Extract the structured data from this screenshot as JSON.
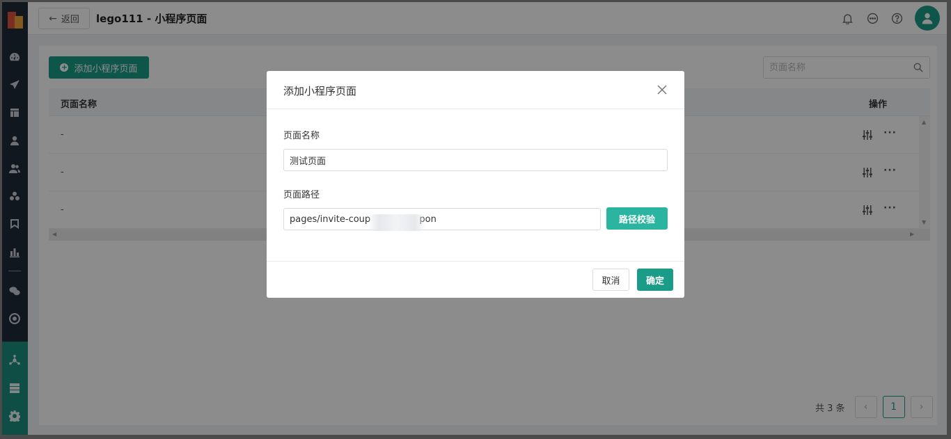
{
  "header": {
    "back_label": "返回",
    "title": "lego111 - 小程序页面"
  },
  "toolbar": {
    "add_label": "添加小程序页面",
    "search_placeholder": "页面名称"
  },
  "table": {
    "columns": [
      "页面名称",
      "操作"
    ],
    "rows": [
      {
        "name": "-"
      },
      {
        "name": "-"
      },
      {
        "name": "-"
      }
    ],
    "more_icon": "···"
  },
  "pagination": {
    "total": "共 3 条",
    "prev": "‹",
    "page": "1",
    "next": "›"
  },
  "modal": {
    "title": "添加小程序页面",
    "name_label": "页面名称",
    "name_value": "测试页面",
    "path_label": "页面路径",
    "path_value": "pages/invite-coup                 pon",
    "verify_label": "路径校验",
    "cancel_label": "取消",
    "ok_label": "确定"
  },
  "colors": {
    "primary": "#1a9c88",
    "sidebar_bg": "#1e2b3a",
    "sidebar_bottom_bg": "#1a8f7e"
  },
  "icons": {
    "sidebar": [
      "dashboard-icon",
      "send-icon",
      "layout-icon",
      "user-icon",
      "users-icon",
      "group-icon",
      "bookmark-icon",
      "bar-chart-icon",
      "wechat-icon",
      "target-icon",
      "org-icon",
      "server-icon",
      "gear-icon"
    ],
    "header": [
      "bell-icon",
      "message-icon",
      "help-icon"
    ]
  }
}
